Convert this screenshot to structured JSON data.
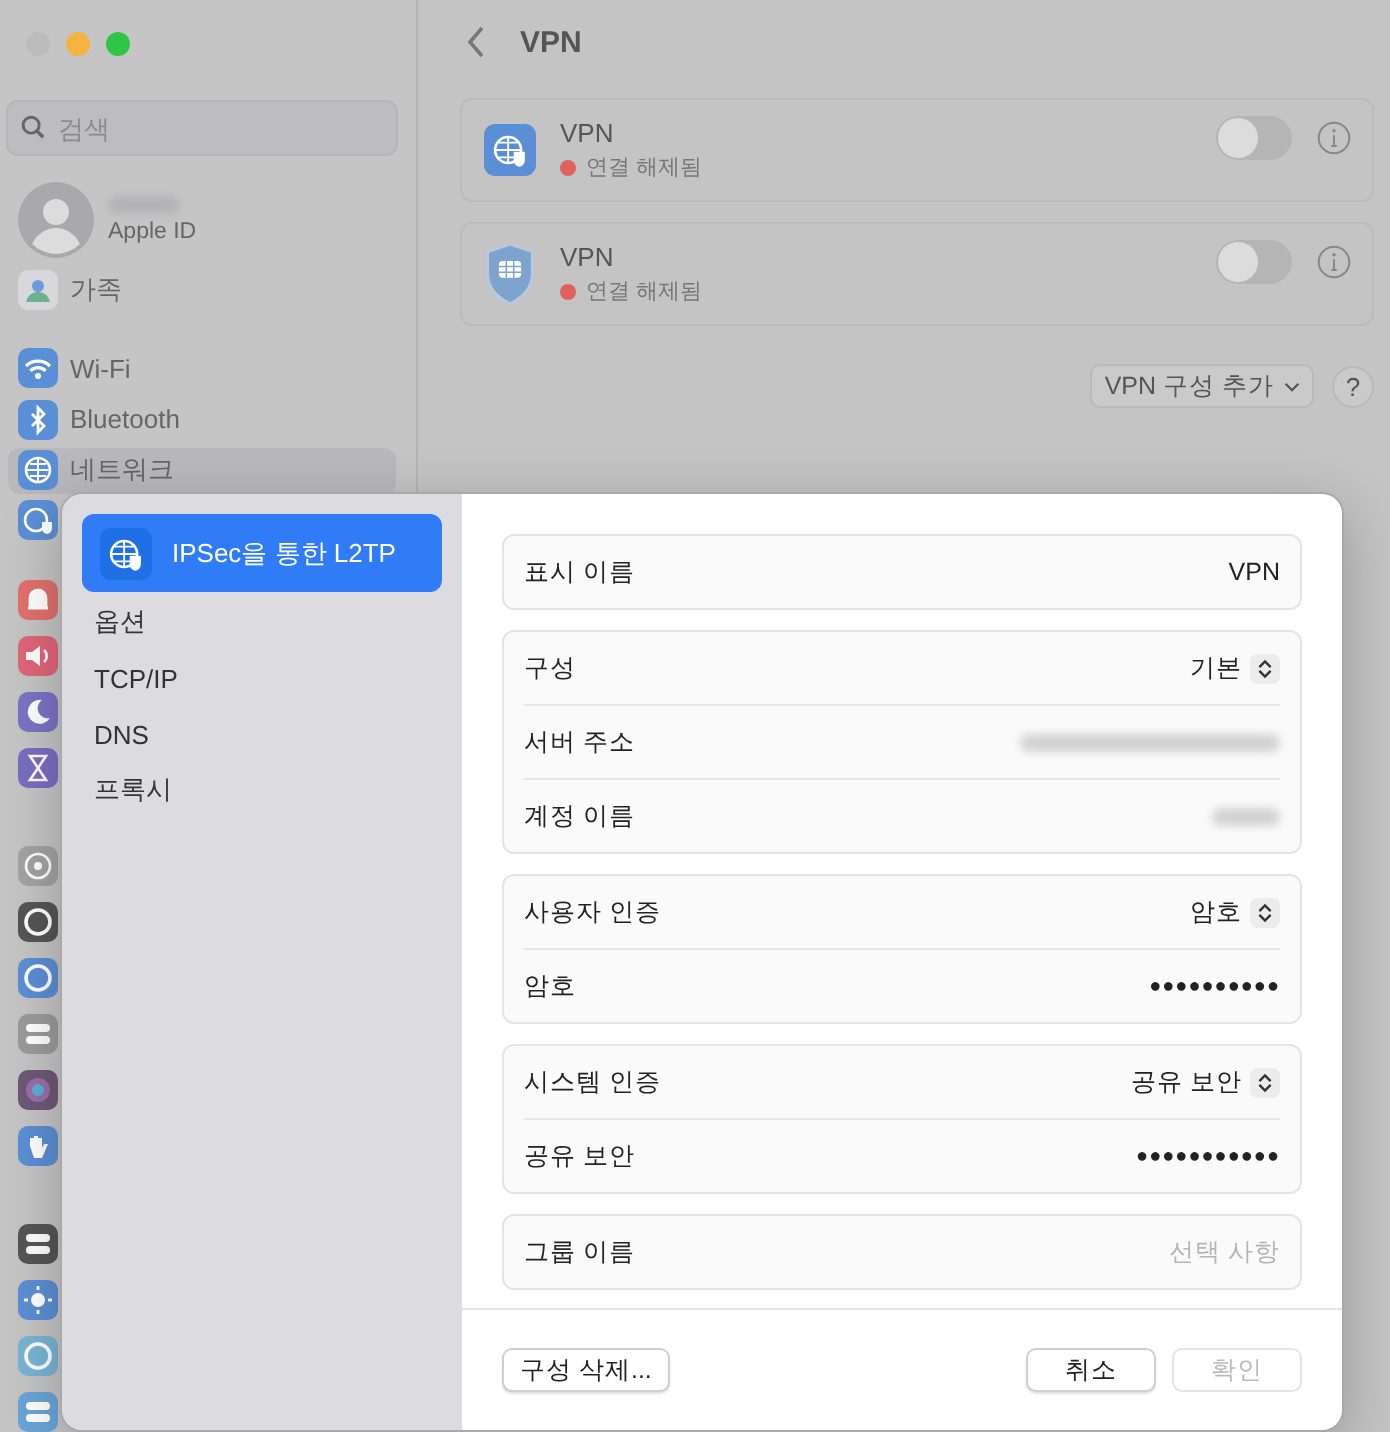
{
  "window": {
    "traffic_lights": [
      {
        "color": "#bdbcbd"
      },
      {
        "color": "#f5b340"
      },
      {
        "color": "#2fc646"
      }
    ]
  },
  "sidebar": {
    "search": {
      "placeholder": "검색"
    },
    "account": {
      "subtitle": "Apple ID"
    },
    "items": [
      {
        "label": "가족",
        "selected": false
      },
      {
        "label": "Wi-Fi",
        "selected": false
      },
      {
        "label": "Bluetooth",
        "selected": false
      },
      {
        "label": "네트워크",
        "selected": true
      }
    ]
  },
  "page": {
    "title": "VPN",
    "services": [
      {
        "name": "VPN",
        "status": "연결 해제됨",
        "color": "#e0625e",
        "on": false
      },
      {
        "name": "VPN",
        "status": "연결 해제됨",
        "color": "#e0625e",
        "on": false
      }
    ],
    "add_button": "VPN 구성 추가",
    "help_button": "?"
  },
  "sheet": {
    "nav": [
      {
        "label": "IPSec을 통한 L2TP",
        "selected": true
      },
      {
        "label": "옵션",
        "selected": false
      },
      {
        "label": "TCP/IP",
        "selected": false
      },
      {
        "label": "DNS",
        "selected": false
      },
      {
        "label": "프록시",
        "selected": false
      }
    ],
    "groups": [
      [
        {
          "kind": "text",
          "label": "표시 이름",
          "value": "VPN"
        }
      ],
      [
        {
          "kind": "popup",
          "label": "구성",
          "value": "기본"
        },
        {
          "kind": "redacted",
          "label": "서버 주소"
        },
        {
          "kind": "redacted",
          "label": "계정 이름"
        }
      ],
      [
        {
          "kind": "popup",
          "label": "사용자 인증",
          "value": "암호"
        },
        {
          "kind": "password",
          "label": "암호",
          "value": "●●●●●●●●●●"
        }
      ],
      [
        {
          "kind": "popup",
          "label": "시스템 인증",
          "value": "공유 보안"
        },
        {
          "kind": "password",
          "label": "공유 보안",
          "value": "●●●●●●●●●●●"
        }
      ],
      [
        {
          "kind": "field",
          "label": "그룹 이름",
          "placeholder": "선택 사항"
        }
      ]
    ],
    "delete_button": "구성 삭제...",
    "actions": [
      {
        "label": "취소",
        "disabled": false
      },
      {
        "label": "확인",
        "disabled": true
      }
    ]
  }
}
